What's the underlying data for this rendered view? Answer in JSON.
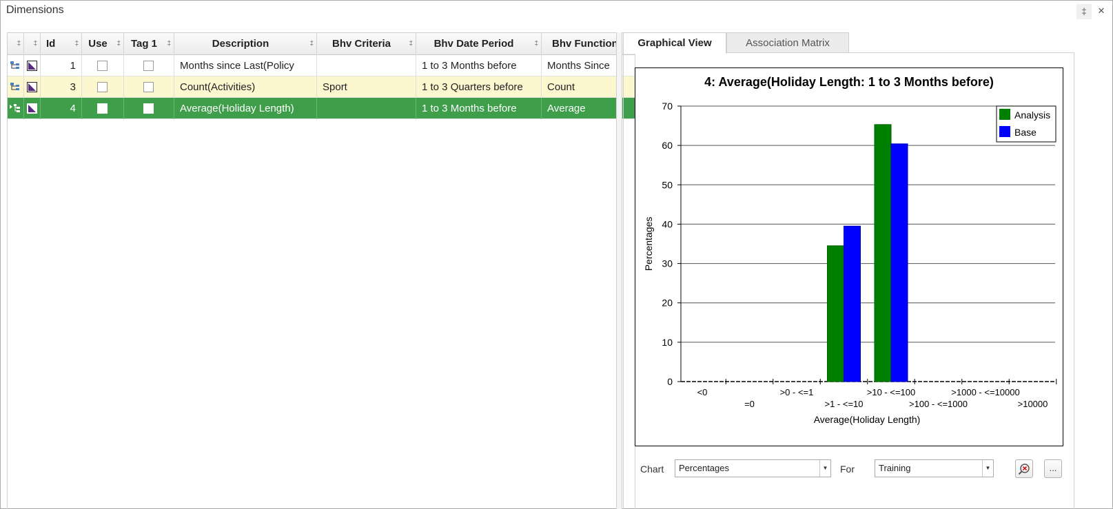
{
  "window": {
    "title": "Dimensions",
    "pin_glyph": "‡",
    "close_glyph": "✕"
  },
  "grid": {
    "columns": [
      "",
      "",
      "Id",
      "Use",
      "Tag 1",
      "Description",
      "Bhv Criteria",
      "Bhv Date Period",
      "Bhv Function"
    ],
    "rows": [
      {
        "id": "1",
        "description": "Months since Last(Policy",
        "criteria": "",
        "date_period": "1 to 3 Months before",
        "function": "Months Since",
        "use": false,
        "tag1": false
      },
      {
        "id": "3",
        "description": "Count(Activities)",
        "criteria": "Sport",
        "date_period": "1 to 3 Quarters before",
        "function": "Count",
        "use": false,
        "tag1": false
      },
      {
        "id": "4",
        "description": "Average(Holiday Length)",
        "criteria": "",
        "date_period": "1 to 3 Months before",
        "function": "Average",
        "use": false,
        "tag1": false
      }
    ]
  },
  "tabs": {
    "graphical": "Graphical View",
    "association": "Association Matrix"
  },
  "controls": {
    "chart_label": "Chart",
    "chart_value": "Percentages",
    "for_label": "For",
    "for_value": "Training",
    "more_label": "...",
    "zoom_icon": "zoom-reset-icon"
  },
  "colors": {
    "analysis": "#008000",
    "base": "#0000ff",
    "active_row": "#3e9e4a",
    "alt_row": "#fdf7d0"
  },
  "chart_data": {
    "type": "bar",
    "title": "4: Average(Holiday Length: 1 to 3 Months before)",
    "xlabel": "Average(Holiday Length)",
    "ylabel": "Percentages",
    "ylim": [
      0,
      70
    ],
    "yticks": [
      0,
      10,
      20,
      30,
      40,
      50,
      60,
      70
    ],
    "categories": [
      "<0",
      "=0",
      ">0 - <=1",
      ">1 - <=10",
      ">10 - <=100",
      ">100 - <=1000",
      ">1000 - <=10000",
      ">10000"
    ],
    "series": [
      {
        "name": "Analysis",
        "color": "#008000",
        "values": [
          0,
          0,
          0,
          34.5,
          65.3,
          0,
          0,
          0
        ]
      },
      {
        "name": "Base",
        "color": "#0000ff",
        "values": [
          0,
          0,
          0,
          39.5,
          60.4,
          0,
          0,
          0
        ]
      }
    ],
    "grid": true,
    "legend": "top-right"
  }
}
